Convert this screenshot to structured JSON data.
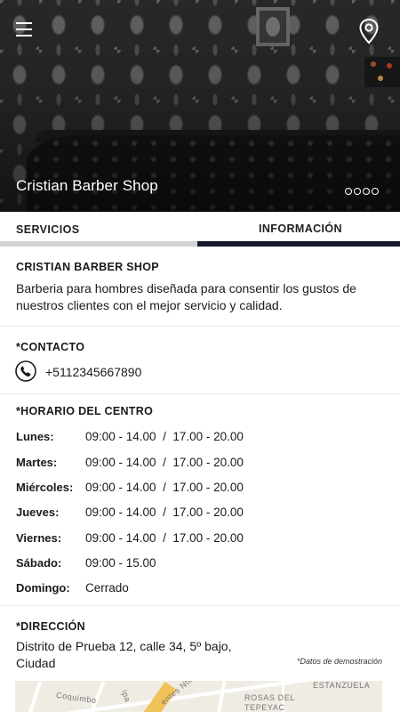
{
  "header": {
    "title": "Cristian Barber Shop",
    "menu_icon": "hamburger-menu-icon",
    "location_icon": "map-pin-icon",
    "carousel_dots": 4
  },
  "tabs": [
    {
      "label": "SERVICIOS",
      "active": false
    },
    {
      "label": "INFORMACIÓN",
      "active": true
    }
  ],
  "about": {
    "name": "CRISTIAN BARBER SHOP",
    "description": "Barberia para hombres diseñada para consentir los gustos de nuestros clientes con el mejor servicio y calidad."
  },
  "contact": {
    "title": "*CONTACTO",
    "icon": "phone-icon",
    "phone": "+5112345667890"
  },
  "schedule": {
    "title": "*HORARIO DEL CENTRO",
    "rows": [
      {
        "day": "Lunes:",
        "hours": "09:00 - 14.00  /  17.00 - 20.00"
      },
      {
        "day": "Martes:",
        "hours": "09:00 - 14.00  /  17.00 - 20.00"
      },
      {
        "day": "Miércoles:",
        "hours": "09:00 - 14.00  /  17.00 - 20.00"
      },
      {
        "day": "Jueves:",
        "hours": "09:00 - 14.00  /  17.00 - 20.00"
      },
      {
        "day": "Viernes:",
        "hours": "09:00 - 14.00  /  17.00 - 20.00"
      },
      {
        "day": "Sábado:",
        "hours": "09:00 - 15.00"
      },
      {
        "day": "Domingo:",
        "hours": "Cerrado"
      }
    ]
  },
  "address": {
    "title": "*DIRECCIÓN",
    "line1": "Distrito de Prueba 12, calle 34, 5º bajo,",
    "line2": "Ciudad",
    "demo_note": "*Datos de demostración"
  },
  "map": {
    "labels": [
      "ESTANZUELA",
      "ROSAS DEL",
      "TEPEYAC",
      "Coquimbo",
      "entes Nte",
      "ipa"
    ]
  },
  "colors": {
    "active_tab": "#14182a",
    "inactive_tab_line": "#d4d4d4",
    "text": "#1a1a1a"
  }
}
